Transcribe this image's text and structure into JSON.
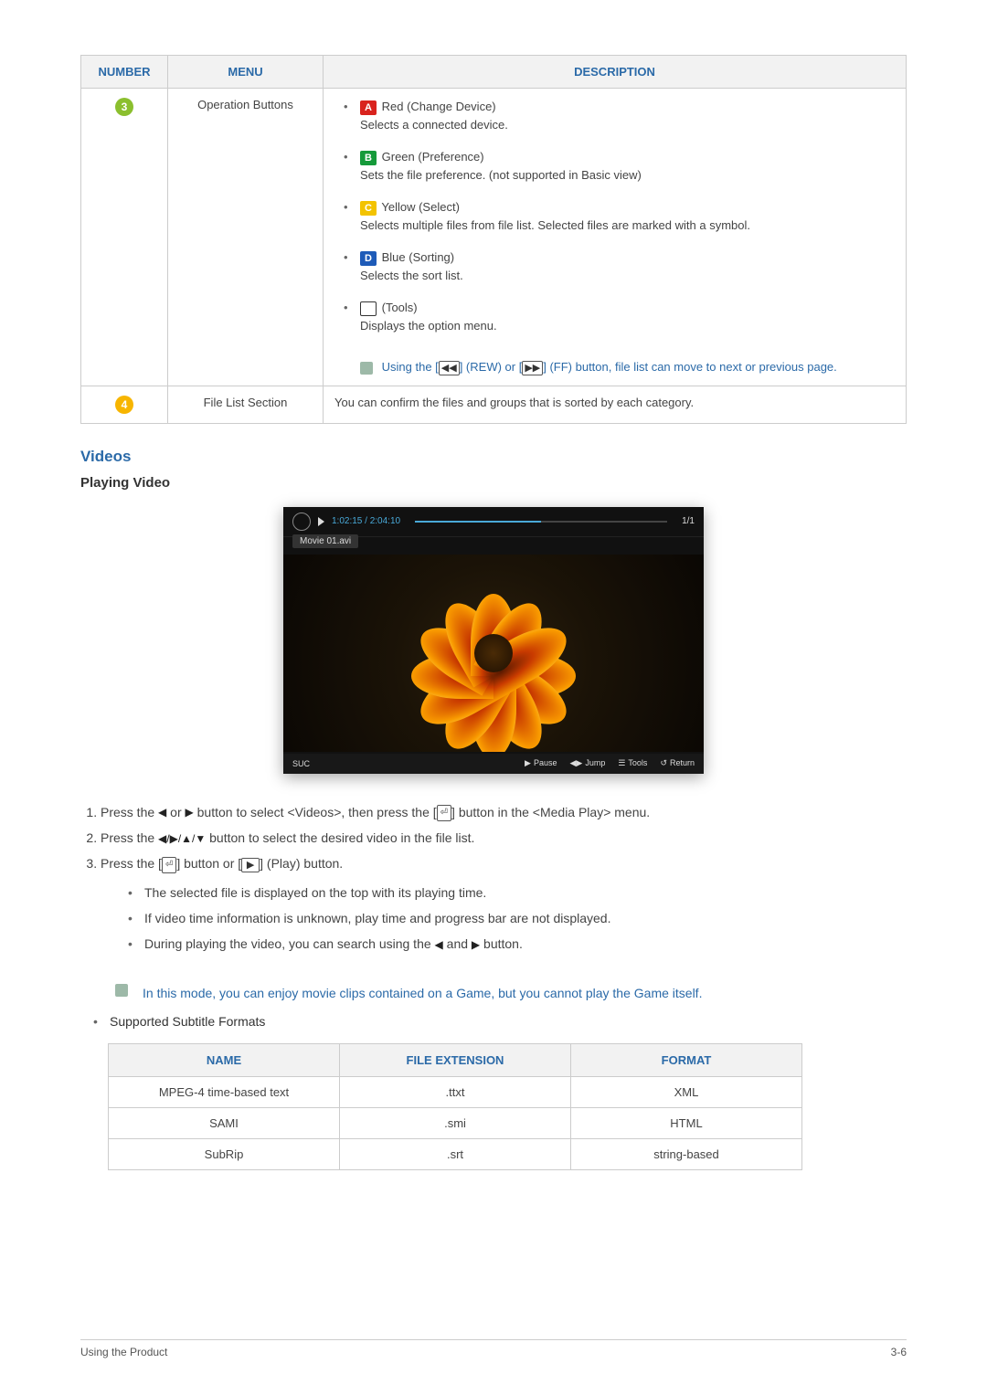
{
  "mainTable": {
    "headers": {
      "number": "NUMBER",
      "menu": "MENU",
      "description": "DESCRIPTION"
    },
    "row3": {
      "num": "3",
      "menu": "Operation Buttons",
      "items": {
        "red": {
          "label": "A",
          "title": "Red (Change Device)",
          "desc": "Selects a connected device."
        },
        "green": {
          "label": "B",
          "title": "Green (Preference)",
          "desc": "Sets the file preference. (not supported in Basic view)"
        },
        "yellow": {
          "label": "C",
          "title": "Yellow (Select)",
          "desc": "Selects multiple files from file list. Selected files are marked with a symbol."
        },
        "blue": {
          "label": "D",
          "title": "Blue (Sorting)",
          "desc": "Selects the sort list."
        },
        "tools": {
          "title": "(Tools)",
          "desc": "Displays the option menu."
        }
      },
      "note": {
        "p1": "Using the [",
        "rew_text": "] (REW) or [",
        "ff_text": "] (FF) button, file list can move to next or previous page."
      }
    },
    "row4": {
      "num": "4",
      "menu": "File List Section",
      "desc": "You can confirm the files and groups that is sorted by each category."
    }
  },
  "videos": {
    "heading": "Videos",
    "subheading": "Playing Video",
    "player": {
      "time": "1:02:15 / 2:04:10",
      "counter": "1/1",
      "filename": "Movie 01.avi",
      "source": "SUC",
      "controls": {
        "pause": "Pause",
        "jump": "Jump",
        "tools": "Tools",
        "ret": "Return"
      }
    },
    "steps": {
      "s1": {
        "a": "Press the ",
        "b": " or ",
        "c": " button to select <Videos>, then press the [",
        "d": "] button in the <Media Play> menu."
      },
      "s2": {
        "a": "Press the ",
        "b": " button to select the desired video in the file list."
      },
      "s3": {
        "a": "Press the [",
        "b": "] button or [",
        "c": "] (Play) button."
      },
      "subs": {
        "a": "The selected file is displayed on the top with its playing time.",
        "b": "If video time information is unknown, play time and progress bar are not displayed.",
        "c1": "During playing the video, you can search using the ",
        "c2": " and ",
        "c3": " button."
      }
    },
    "modeNote": "In this mode, you can enjoy movie clips contained on a Game, but you cannot play the Game itself.",
    "subtitleLead": "Supported Subtitle Formats",
    "subtitleTable": {
      "headers": {
        "name": "NAME",
        "ext": "FILE EXTENSION",
        "format": "FORMAT"
      },
      "rows": [
        {
          "name": "MPEG-4 time-based text",
          "ext": ".ttxt",
          "format": "XML"
        },
        {
          "name": "SAMI",
          "ext": ".smi",
          "format": "HTML"
        },
        {
          "name": "SubRip",
          "ext": ".srt",
          "format": "string-based"
        }
      ]
    }
  },
  "footer": {
    "left": "Using the Product",
    "right": "3-6"
  }
}
